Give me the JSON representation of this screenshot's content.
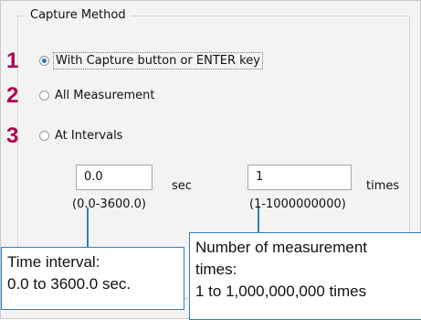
{
  "group": {
    "title": "Capture Method"
  },
  "markers": [
    "1",
    "2",
    "3"
  ],
  "options": [
    {
      "label": "With Capture button or ENTER key",
      "selected": true
    },
    {
      "label": "All Measurement",
      "selected": false
    },
    {
      "label": "At Intervals",
      "selected": false
    }
  ],
  "interval": {
    "value": "0.0",
    "unit": "sec",
    "range": "(0.0-3600.0)"
  },
  "times": {
    "value": "1",
    "unit": "times",
    "range": "(1-1000000000)"
  },
  "callouts": {
    "interval": {
      "line1": "Time interval:",
      "line2": "0.0 to 3600.0 sec."
    },
    "times": {
      "line1": "Number of measurement",
      "line2": "times:",
      "line3": "1 to 1,000,000,000 times"
    }
  },
  "colors": {
    "marker": "#b0004f",
    "accent": "#2f7fc1",
    "radio_selected": "#2b78c2"
  }
}
